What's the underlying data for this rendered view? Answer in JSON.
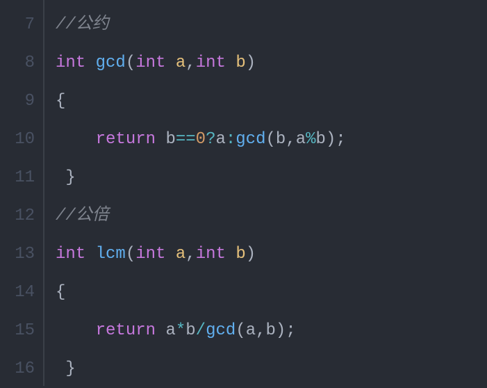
{
  "lines": [
    {
      "num": "7"
    },
    {
      "num": "8"
    },
    {
      "num": "9"
    },
    {
      "num": "10"
    },
    {
      "num": "11"
    },
    {
      "num": "12"
    },
    {
      "num": "13"
    },
    {
      "num": "14"
    },
    {
      "num": "15"
    },
    {
      "num": "16"
    }
  ],
  "code": {
    "l7": {
      "comment": "//公约"
    },
    "l8": {
      "kw_int1": "int",
      "fn": "gcd",
      "lp": "(",
      "kw_int2": "int",
      "a": "a",
      "comma": ",",
      "kw_int3": "int",
      "b": "b",
      "rp": ")"
    },
    "l9": {
      "brace": "{"
    },
    "l10": {
      "kw_return": "return",
      "b1": "b",
      "eq": "==",
      "zero": "0",
      "qmark": "?",
      "a1": "a",
      "colon": ":",
      "fn": "gcd",
      "lp": "(",
      "b2": "b",
      "comma": ",",
      "a2": "a",
      "mod": "%",
      "b3": "b",
      "rp": ")",
      "semi": ";"
    },
    "l11": {
      "brace": "}"
    },
    "l12": {
      "comment": "//公倍"
    },
    "l13": {
      "kw_int1": "int",
      "fn": "lcm",
      "lp": "(",
      "kw_int2": "int",
      "a": "a",
      "comma": ",",
      "kw_int3": "int",
      "b": "b",
      "rp": ")"
    },
    "l14": {
      "brace": "{"
    },
    "l15": {
      "kw_return": "return",
      "a1": "a",
      "mul": "*",
      "b1": "b",
      "div": "/",
      "fn": "gcd",
      "lp": "(",
      "a2": "a",
      "comma": ",",
      "b2": "b",
      "rp": ")",
      "semi": ";"
    },
    "l16": {
      "brace": "}"
    }
  }
}
